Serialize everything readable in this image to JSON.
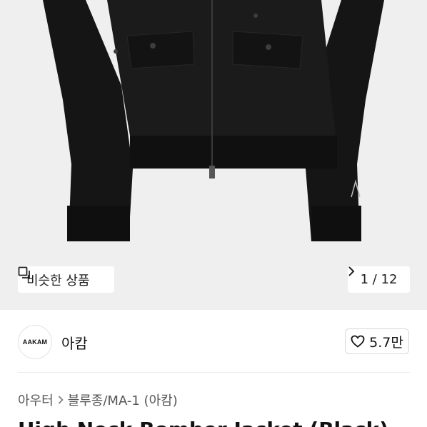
{
  "hero": {
    "similar_label": "비슷한 상품",
    "counter": "1 / 12",
    "colors": {
      "background": "#efefef",
      "jacket": "#171717"
    }
  },
  "seller": {
    "logo_text": "AAKAM",
    "name": "아캄",
    "likes": "5.7만"
  },
  "breadcrumb": {
    "items": [
      "아우터",
      "블루종/MA-1 (아캄)"
    ]
  },
  "product": {
    "title": "High Neck Bomber Jacket (Black)"
  }
}
